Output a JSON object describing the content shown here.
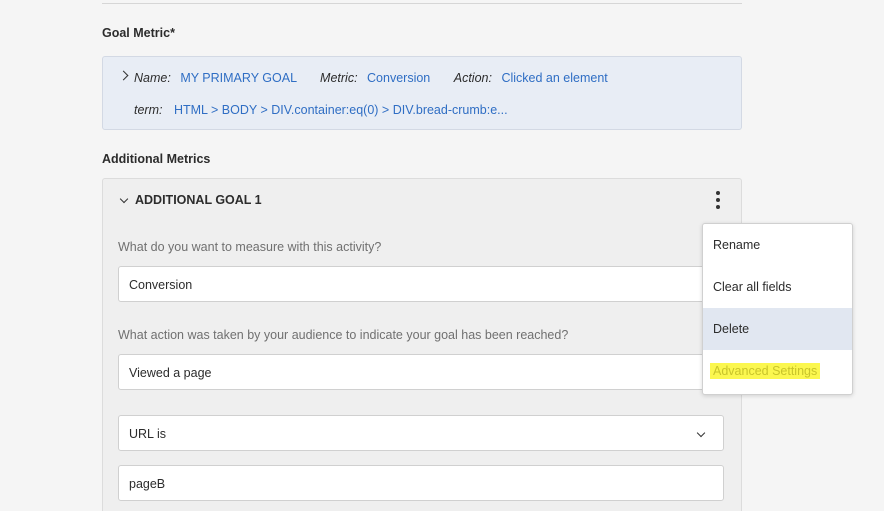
{
  "goal_metric": {
    "label": "Goal Metric*",
    "name_key": "Name:",
    "name_val": "MY PRIMARY GOAL",
    "metric_key": "Metric:",
    "metric_val": "Conversion",
    "action_key": "Action:",
    "action_val": "Clicked an element",
    "term_key": "term:",
    "term_val": "HTML > BODY > DIV.container:eq(0) > DIV.bread-crumb:e..."
  },
  "additional_metrics": {
    "label": "Additional Metrics",
    "goal_title": "ADDITIONAL GOAL 1",
    "q1": "What do you want to measure with this activity?",
    "q1_value": "Conversion",
    "q2": "What action was taken by your audience to indicate your goal has been reached?",
    "q2_value": "Viewed a page",
    "url_condition": "URL is",
    "url_value": "pageB"
  },
  "context_menu": {
    "items": [
      "Rename",
      "Clear all fields",
      "Delete",
      "Advanced Settings"
    ]
  },
  "colors": {
    "link": "#2f6ec4",
    "highlight": "#fbf74f"
  }
}
